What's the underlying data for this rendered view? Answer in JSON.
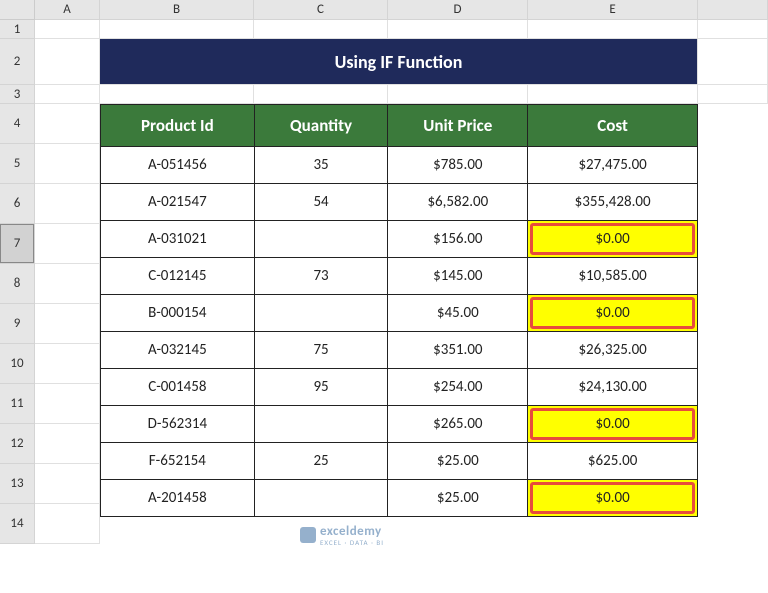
{
  "columns": [
    "A",
    "B",
    "C",
    "D",
    "E",
    ""
  ],
  "rows": [
    "1",
    "2",
    "3",
    "4",
    "5",
    "6",
    "7",
    "8",
    "9",
    "10",
    "11",
    "12",
    "13",
    "14"
  ],
  "selectedRow": "7",
  "title": "Using IF Function",
  "headers": {
    "col1": "Product Id",
    "col2": "Quantity",
    "col3": "Unit Price",
    "col4": "Cost"
  },
  "data": [
    {
      "id": "A-051456",
      "qty": "35",
      "price": "$785.00",
      "cost": "$27,475.00",
      "hl": false
    },
    {
      "id": "A-021547",
      "qty": "54",
      "price": "$6,582.00",
      "cost": "$355,428.00",
      "hl": false
    },
    {
      "id": "A-031021",
      "qty": "",
      "price": "$156.00",
      "cost": "$0.00",
      "hl": true
    },
    {
      "id": "C-012145",
      "qty": "73",
      "price": "$145.00",
      "cost": "$10,585.00",
      "hl": false
    },
    {
      "id": "B-000154",
      "qty": "",
      "price": "$45.00",
      "cost": "$0.00",
      "hl": true
    },
    {
      "id": "A-032145",
      "qty": "75",
      "price": "$351.00",
      "cost": "$26,325.00",
      "hl": false
    },
    {
      "id": "C-001458",
      "qty": "95",
      "price": "$254.00",
      "cost": "$24,130.00",
      "hl": false
    },
    {
      "id": "D-562314",
      "qty": "",
      "price": "$265.00",
      "cost": "$0.00",
      "hl": true
    },
    {
      "id": "F-652154",
      "qty": "25",
      "price": "$25.00",
      "cost": "$625.00",
      "hl": false
    },
    {
      "id": "A-201458",
      "qty": "",
      "price": "$25.00",
      "cost": "$0.00",
      "hl": true
    }
  ],
  "watermark": {
    "brand": "exceldemy",
    "tag": "EXCEL · DATA · BI"
  },
  "chart_data": {
    "type": "table",
    "title": "Using IF Function",
    "columns": [
      "Product Id",
      "Quantity",
      "Unit Price",
      "Cost"
    ],
    "rows": [
      [
        "A-051456",
        35,
        785.0,
        27475.0
      ],
      [
        "A-021547",
        54,
        6582.0,
        355428.0
      ],
      [
        "A-031021",
        null,
        156.0,
        0.0
      ],
      [
        "C-012145",
        73,
        145.0,
        10585.0
      ],
      [
        "B-000154",
        null,
        45.0,
        0.0
      ],
      [
        "A-032145",
        75,
        351.0,
        26325.0
      ],
      [
        "C-001458",
        95,
        254.0,
        24130.0
      ],
      [
        "D-562314",
        null,
        265.0,
        0.0
      ],
      [
        "F-652154",
        25,
        25.0,
        625.0
      ],
      [
        "A-201458",
        null,
        25.0,
        0.0
      ]
    ]
  }
}
